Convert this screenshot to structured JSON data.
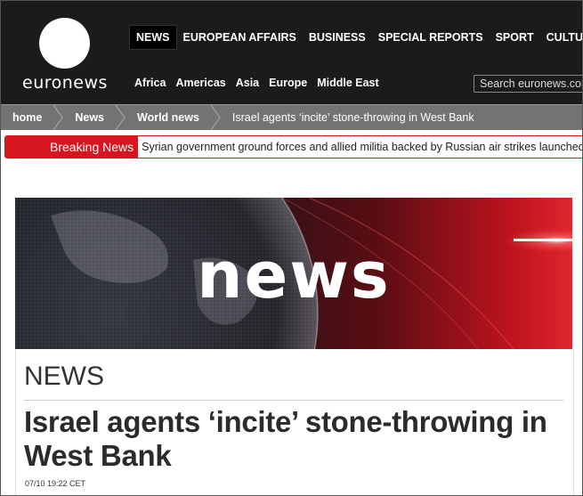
{
  "header": {
    "logo_text": "euronews",
    "nav": [
      "NEWS",
      "EUROPEAN AFFAIRS",
      "BUSINESS",
      "SPECIAL REPORTS",
      "SPORT",
      "CULTURE"
    ],
    "regions": [
      "Africa",
      "Americas",
      "Asia",
      "Europe",
      "Middle East"
    ],
    "search_placeholder": "Search euronews.com"
  },
  "breadcrumb": [
    "home",
    "News",
    "World news",
    "Israel agents ‘incite’ stone-throwing in West Bank"
  ],
  "breaking": {
    "label": "Breaking News",
    "text": "Syrian government ground forces and allied militia backed by Russian air strikes launched a"
  },
  "hero": {
    "word": "news"
  },
  "article": {
    "section": "NEWS",
    "headline": "Israel agents ‘incite’ stone-throwing in West Bank",
    "date": "07/10 19:22 CET"
  },
  "colors": {
    "header_bg": "#1b1b1b",
    "breadcrumb_bg": "#737373",
    "breaking_red": "#d7151e"
  }
}
